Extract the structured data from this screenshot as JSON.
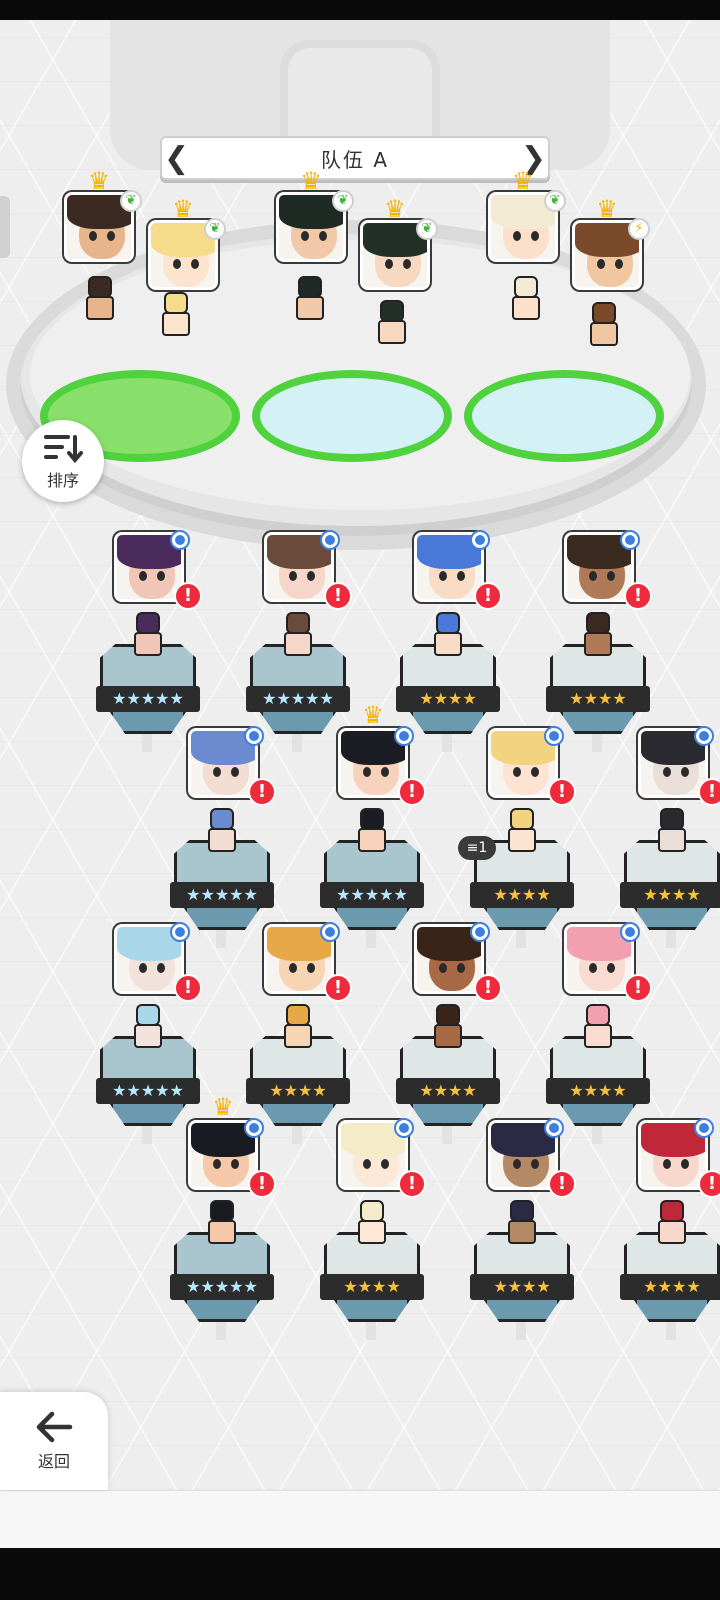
{
  "team": {
    "title": "队伍 A",
    "left_arrow": "❮",
    "right_arrow": "❯",
    "members": [
      {
        "name": "hero-dark-hair-brown",
        "hair": "#3b2a22",
        "skin": "#e7b48c",
        "element": "leaf",
        "leader": true
      },
      {
        "name": "hero-blonde-ribbon",
        "hair": "#f4dc8a",
        "skin": "#fde4cf",
        "element": "leaf",
        "leader": true
      },
      {
        "name": "hero-black-hair-red",
        "hair": "#1e2a24",
        "skin": "#f2c9a8",
        "element": "leaf",
        "leader": true
      },
      {
        "name": "hero-black-hair-green",
        "hair": "#233028",
        "skin": "#f7d8c0",
        "element": "leaf",
        "leader": true
      },
      {
        "name": "hero-white-hair-gold",
        "hair": "#f2ead2",
        "skin": "#fde0cc",
        "element": "leaf",
        "leader": true
      },
      {
        "name": "hero-brown-hair-glasses",
        "hair": "#7a4a2a",
        "skin": "#f1c7a2",
        "element": "bolt",
        "leader": true
      }
    ]
  },
  "sort_button": {
    "label": "排序",
    "icon": "sort-icon"
  },
  "back_button": {
    "label": "返回",
    "icon": "back-arrow-icon"
  },
  "roster": [
    {
      "id": 1,
      "hair": "#4b2a5c",
      "skin": "#f0c6b8",
      "stars": "★★★★★",
      "rank": 5,
      "crown": false,
      "dup": ""
    },
    {
      "id": 2,
      "hair": "#6a4a3a",
      "skin": "#f6d6c8",
      "stars": "★★★★★",
      "rank": 5,
      "crown": false,
      "dup": ""
    },
    {
      "id": 3,
      "hair": "#4a78d8",
      "skin": "#f9dcc6",
      "stars": "★★★★",
      "rank": 4,
      "crown": false,
      "dup": ""
    },
    {
      "id": 4,
      "hair": "#3a2a20",
      "skin": "#b07a58",
      "stars": "★★★★",
      "rank": 4,
      "crown": false,
      "dup": ""
    },
    {
      "id": 5,
      "hair": "#6c8ad0",
      "skin": "#f3dcd2",
      "stars": "★★★★★",
      "rank": 5,
      "crown": false,
      "dup": ""
    },
    {
      "id": 6,
      "hair": "#1c1c24",
      "skin": "#f6d2bc",
      "stars": "★★★★★",
      "rank": 5,
      "crown": true,
      "dup": ""
    },
    {
      "id": 7,
      "hair": "#f2d480",
      "skin": "#fde4d2",
      "stars": "★★★★",
      "rank": 4,
      "crown": false,
      "dup": "1"
    },
    {
      "id": 8,
      "hair": "#2a2a30",
      "skin": "#eadfd8",
      "stars": "★★★★",
      "rank": 4,
      "crown": false,
      "dup": ""
    },
    {
      "id": 9,
      "hair": "#a9d6e8",
      "skin": "#f1e2dc",
      "stars": "★★★★★",
      "rank": 5,
      "crown": false,
      "dup": ""
    },
    {
      "id": 10,
      "hair": "#e9a848",
      "skin": "#f6d4b4",
      "stars": "★★★★",
      "rank": 4,
      "crown": false,
      "dup": ""
    },
    {
      "id": 11,
      "hair": "#3a2418",
      "skin": "#a86a46",
      "stars": "★★★★",
      "rank": 4,
      "crown": false,
      "dup": ""
    },
    {
      "id": 12,
      "hair": "#f2a0b0",
      "skin": "#f8dcd2",
      "stars": "★★★★",
      "rank": 4,
      "crown": false,
      "dup": ""
    },
    {
      "id": 13,
      "hair": "#1a1a22",
      "skin": "#f4c8a8",
      "stars": "★★★★★",
      "rank": 5,
      "crown": true,
      "dup": ""
    },
    {
      "id": 14,
      "hair": "#f4ecc8",
      "skin": "#fde8d8",
      "stars": "★★★★",
      "rank": 4,
      "crown": false,
      "dup": ""
    },
    {
      "id": 15,
      "hair": "#2a2a44",
      "skin": "#b48a66",
      "stars": "★★★★",
      "rank": 4,
      "crown": false,
      "dup": ""
    },
    {
      "id": 16,
      "hair": "#c0283a",
      "skin": "#f8d8cc",
      "stars": "★★★★",
      "rank": 4,
      "crown": false,
      "dup": ""
    }
  ],
  "alert_mark": "!",
  "colors": {
    "alert": "#ef2a3c",
    "new_dot": "#3d7fe0",
    "star_gold": "#f6c23e",
    "star_rainbow": "#b8e6ff",
    "pad_green": "#4fd23e"
  }
}
